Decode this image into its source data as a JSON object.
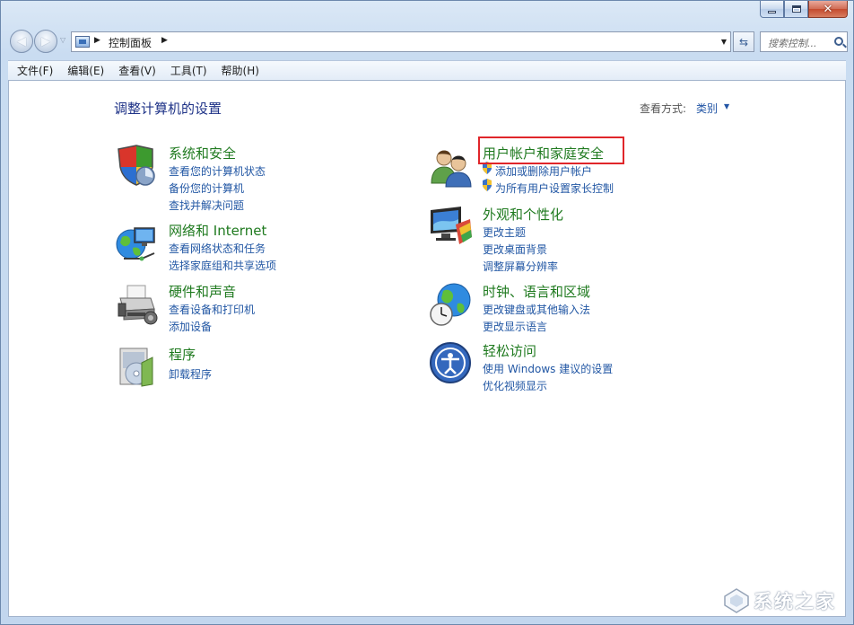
{
  "window": {
    "caption": {
      "minimize": "",
      "maximize": "",
      "close": "✕"
    }
  },
  "address_bar": {
    "breadcrumb": [
      "控制面板"
    ],
    "search_placeholder": "搜索控制..."
  },
  "menu": [
    "文件(F)",
    "编辑(E)",
    "查看(V)",
    "工具(T)",
    "帮助(H)"
  ],
  "main": {
    "title": "调整计算机的设置",
    "view_by_label": "查看方式:",
    "view_by_value": "类别",
    "categories": [
      {
        "id": "system",
        "icon": "shield-icon",
        "title": "系统和安全",
        "links": [
          "查看您的计算机状态",
          "备份您的计算机",
          "查找并解决问题"
        ]
      },
      {
        "id": "network",
        "icon": "network-globe-icon",
        "title": "网络和 Internet",
        "links": [
          "查看网络状态和任务",
          "选择家庭组和共享选项"
        ]
      },
      {
        "id": "hardware",
        "icon": "printer-icon",
        "title": "硬件和声音",
        "links": [
          "查看设备和打印机",
          "添加设备"
        ]
      },
      {
        "id": "programs",
        "icon": "programs-icon",
        "title": "程序",
        "links": [
          "卸载程序"
        ]
      },
      {
        "id": "users",
        "icon": "users-icon",
        "title": "用户帐户和家庭安全",
        "links": [
          "添加或删除用户帐户",
          "为所有用户设置家长控制"
        ]
      },
      {
        "id": "appearance",
        "icon": "monitor-icon",
        "title": "外观和个性化",
        "links": [
          "更改主题",
          "更改桌面背景",
          "调整屏幕分辨率"
        ]
      },
      {
        "id": "clock",
        "icon": "clock-globe-icon",
        "title": "时钟、语言和区域",
        "links": [
          "更改键盘或其他输入法",
          "更改显示语言"
        ]
      },
      {
        "id": "ease",
        "icon": "ease-of-access-icon",
        "title": "轻松访问",
        "links": [
          "使用 Windows 建议的设置",
          "优化视频显示"
        ]
      }
    ]
  },
  "watermark": {
    "text": "系统之家"
  }
}
